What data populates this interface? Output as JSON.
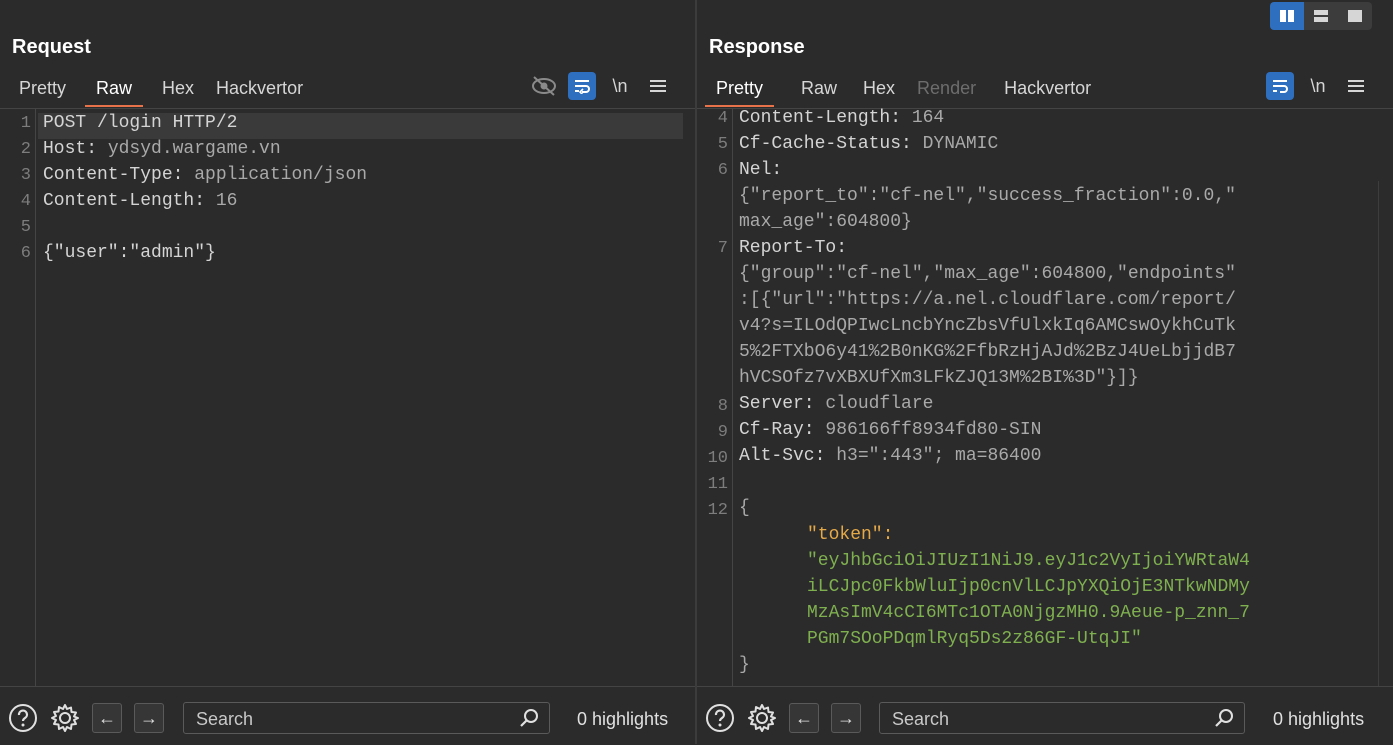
{
  "request": {
    "title": "Request",
    "tabs": [
      "Pretty",
      "Raw",
      "Hex",
      "Hackvertor"
    ],
    "active_tab": "Raw",
    "icons": [
      "eye-off-icon",
      "wrap-icon",
      "newline-icon",
      "menu-icon"
    ],
    "newline_label": "\\n",
    "line_numbers": [
      "1",
      "2",
      "3",
      "4",
      "5",
      "6"
    ],
    "lines": [
      {
        "key": "POST /login HTTP/2",
        "value": ""
      },
      {
        "key": "Host:",
        "value": " ydsyd.wargame.vn"
      },
      {
        "key": "Content-Type:",
        "value": " application/json"
      },
      {
        "key": "Content-Length:",
        "value": " 16"
      },
      {
        "key": "",
        "value": ""
      },
      {
        "key": "",
        "value": "{\"user\":\"admin\"}"
      }
    ],
    "search_placeholder": "Search",
    "highlights": "0 highlights"
  },
  "response": {
    "title": "Response",
    "tabs": [
      "Pretty",
      "Raw",
      "Hex",
      "Render",
      "Hackvertor"
    ],
    "active_tab": "Pretty",
    "disabled_tab": "Render",
    "newline_label": "\\n",
    "headers": [
      {
        "num": "4",
        "key": "Content-Length:",
        "value": " 164"
      },
      {
        "num": "5",
        "key": "Cf-Cache-Status:",
        "value": " DYNAMIC"
      },
      {
        "num": "6",
        "key": "Nel:",
        "value": ""
      },
      {
        "num": "",
        "key": "",
        "value": "{\"report_to\":\"cf-nel\",\"success_fraction\":0.0,\""
      },
      {
        "num": "",
        "key": "",
        "value": "max_age\":604800}"
      },
      {
        "num": "7",
        "key": "Report-To:",
        "value": ""
      },
      {
        "num": "",
        "key": "",
        "value": "{\"group\":\"cf-nel\",\"max_age\":604800,\"endpoints\""
      },
      {
        "num": "",
        "key": "",
        "value": ":[{\"url\":\"https://a.nel.cloudflare.com/report/"
      },
      {
        "num": "",
        "key": "",
        "value": "v4?s=ILOdQPIwcLncbYncZbsVfUlxkIq6AMCswOykhCuTk"
      },
      {
        "num": "",
        "key": "",
        "value": "5%2FTXbO6y41%2B0nKG%2FfbRzHjAJd%2BzJ4UeLbjjdB7"
      },
      {
        "num": "",
        "key": "",
        "value": "hVCSOfz7vXBXUfXm3LFkZJQ13M%2BI%3D\"}]}"
      },
      {
        "num": "8",
        "key": "Server:",
        "value": " cloudflare"
      },
      {
        "num": "9",
        "key": "Cf-Ray:",
        "value": " 986166ff8934fd80-SIN"
      },
      {
        "num": "10",
        "key": "Alt-Svc:",
        "value": " h3=\":443\"; ma=86400"
      },
      {
        "num": "11",
        "key": "",
        "value": ""
      },
      {
        "num": "12",
        "key": "",
        "value": "{"
      }
    ],
    "token_key": "\"token\":",
    "token_lines": [
      "\"eyJhbGciOiJIUzI1NiJ9.eyJ1c2VyIjoiYWRtaW4",
      "iLCJpc0FkbWluIjp0cnVlLCJpYXQiOjE3NTkwNDMy",
      "MzAsImV4cCI6MTc1OTA0NjgzMH0.9Aeue-p_znn_7",
      "PGm7SOoPDqmlRyq5Ds2z86GF-UtqJI\""
    ],
    "closing_brace": "}",
    "search_placeholder": "Search",
    "highlights": "0 highlights"
  },
  "layout_buttons": [
    "split-vertical-icon",
    "split-horizontal-icon",
    "single-pane-icon"
  ],
  "colors": {
    "accent": "#2f6fbf",
    "tab_underline": "#e8734a",
    "json_key": "#e5a948",
    "json_string": "#7fb04f"
  }
}
